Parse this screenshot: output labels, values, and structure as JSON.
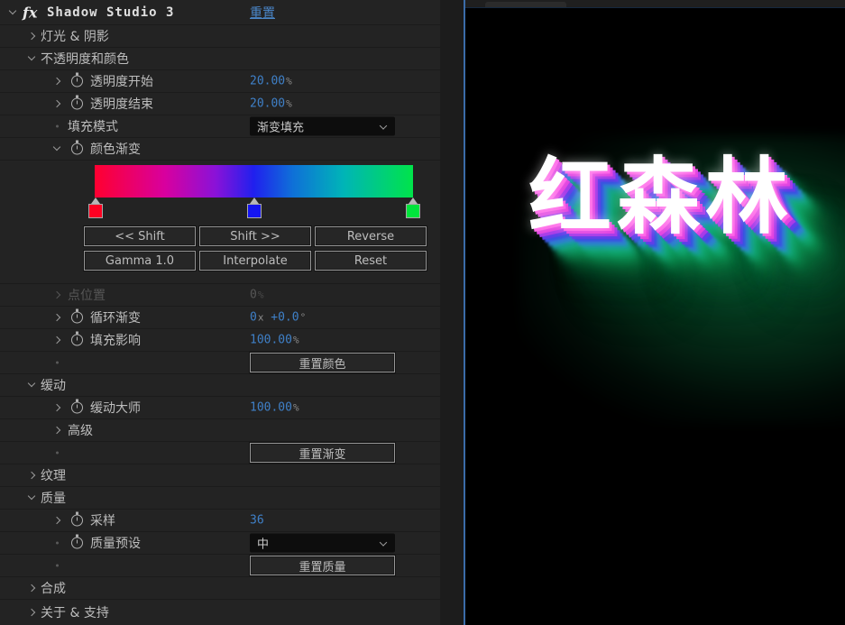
{
  "panel": {
    "fx_badge": "fx",
    "title": "Shadow Studio 3",
    "reset_link": "重置",
    "rows": {
      "lights_shadows": "灯光 & 阴影",
      "opacity_color": "不透明度和颜色",
      "opacity_start": "透明度开始",
      "opacity_start_value": "20.00",
      "opacity_start_unit": "%",
      "opacity_end": "透明度结束",
      "opacity_end_value": "20.00",
      "opacity_end_unit": "%",
      "fill_mode": "填充模式",
      "fill_mode_selected": "渐变填充",
      "color_gradient": "颜色渐变",
      "point_position": "点位置",
      "point_position_value": "0",
      "point_position_unit": "%",
      "cycle_gradient": "循环渐变",
      "cycle_rev": "0",
      "cycle_rev_unit": "x",
      "cycle_deg": "+0.0",
      "cycle_deg_unit": "°",
      "fill_influence": "填充影响",
      "fill_influence_value": "100.00",
      "fill_influence_unit": "%",
      "reset_colors": "重置颜色",
      "easing": "缓动",
      "easing_master": "缓动大师",
      "easing_master_value": "100.00",
      "easing_master_unit": "%",
      "advanced": "高级",
      "reset_gradient": "重置渐变",
      "texture": "纹理",
      "quality": "质量",
      "sampling": "采样",
      "sampling_value": "36",
      "quality_preset": "质量预设",
      "quality_preset_selected": "中",
      "reset_quality": "重置质量",
      "compositing": "合成",
      "about_support": "关于 & 支持"
    },
    "gradient_buttons": {
      "shift_left": "<< Shift",
      "shift_right": "Shift >>",
      "reverse": "Reverse",
      "gamma": "Gamma 1.0",
      "interpolate": "Interpolate",
      "reset": "Reset"
    },
    "gradient": {
      "stops": [
        {
          "color": "#ff0022",
          "position_pct": 0
        },
        {
          "color": "#1414f0",
          "position_pct": 50
        },
        {
          "color": "#00e43c",
          "position_pct": 100
        }
      ]
    }
  },
  "preview": {
    "text": "红森林"
  },
  "colors": {
    "panel_bg": "#232323",
    "row_separator": "#1b1b1b",
    "value_blue": "#3f80c8",
    "link_blue": "#4a86c8",
    "divider_blue": "#3b6ca8",
    "shadow_magenta": "#e23fe0",
    "shadow_blue": "#3a55e0",
    "shadow_teal": "#14ad7c",
    "glow_green": "#12aa5f"
  }
}
